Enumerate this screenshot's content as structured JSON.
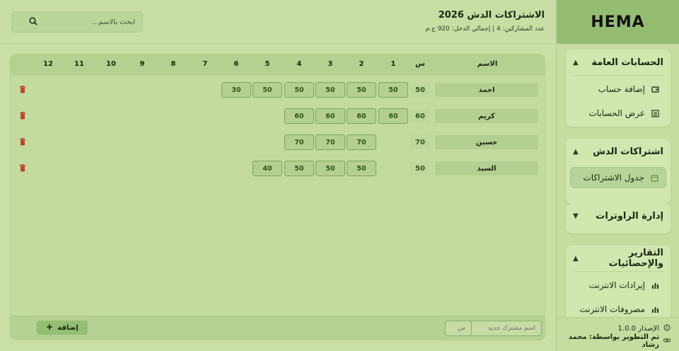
{
  "brand": "HEMA",
  "header": {
    "title": "الاشتراكات الدش 2026",
    "subtitle": "عدد المشاركين: 4 | إجمالي الدخل: 920 ج.م"
  },
  "search": {
    "placeholder": "ابحث بالاسم..."
  },
  "sidebar": {
    "sections": [
      {
        "title": "الحسابات العامة",
        "items": [
          {
            "label": "إضافة حساب"
          },
          {
            "label": "عرض الحسابات"
          }
        ]
      },
      {
        "title": "اشتراكات الدش",
        "items": [
          {
            "label": "جدول الاشتراكات"
          }
        ]
      },
      {
        "title": "إدارة الراوترات",
        "items": []
      },
      {
        "title": "التقارير والإحصائيات",
        "items": [
          {
            "label": "إيرادات الانترنت"
          },
          {
            "label": "مصروفات الانترنت"
          }
        ]
      }
    ],
    "footer": {
      "version": "الإصدار 1.0.0",
      "developer": "تم التطوير بواسطة: محمد رشاد"
    }
  },
  "table": {
    "headers": {
      "name": "الاسم",
      "s": "س",
      "months": [
        "1",
        "2",
        "3",
        "4",
        "5",
        "6",
        "7",
        "8",
        "9",
        "10",
        "11",
        "12"
      ]
    },
    "rows": [
      {
        "name": "احمد",
        "s": "50",
        "payments": [
          "50",
          "50",
          "50",
          "50",
          "50",
          "30"
        ]
      },
      {
        "name": "كريم",
        "s": "60",
        "payments": [
          "60",
          "60",
          "60",
          "60"
        ]
      },
      {
        "name": "حسين",
        "s": "70",
        "payments": [
          "",
          "70",
          "70",
          "70"
        ]
      },
      {
        "name": "السيد",
        "s": "50",
        "payments": [
          "",
          "50",
          "50",
          "50",
          "40"
        ]
      }
    ]
  },
  "footer_form": {
    "name_placeholder": "اسم مشترك جديد",
    "s_placeholder": "س",
    "add_label": "إضافة"
  },
  "colors": {
    "accent": "#93bf73",
    "danger": "#c0442e"
  }
}
